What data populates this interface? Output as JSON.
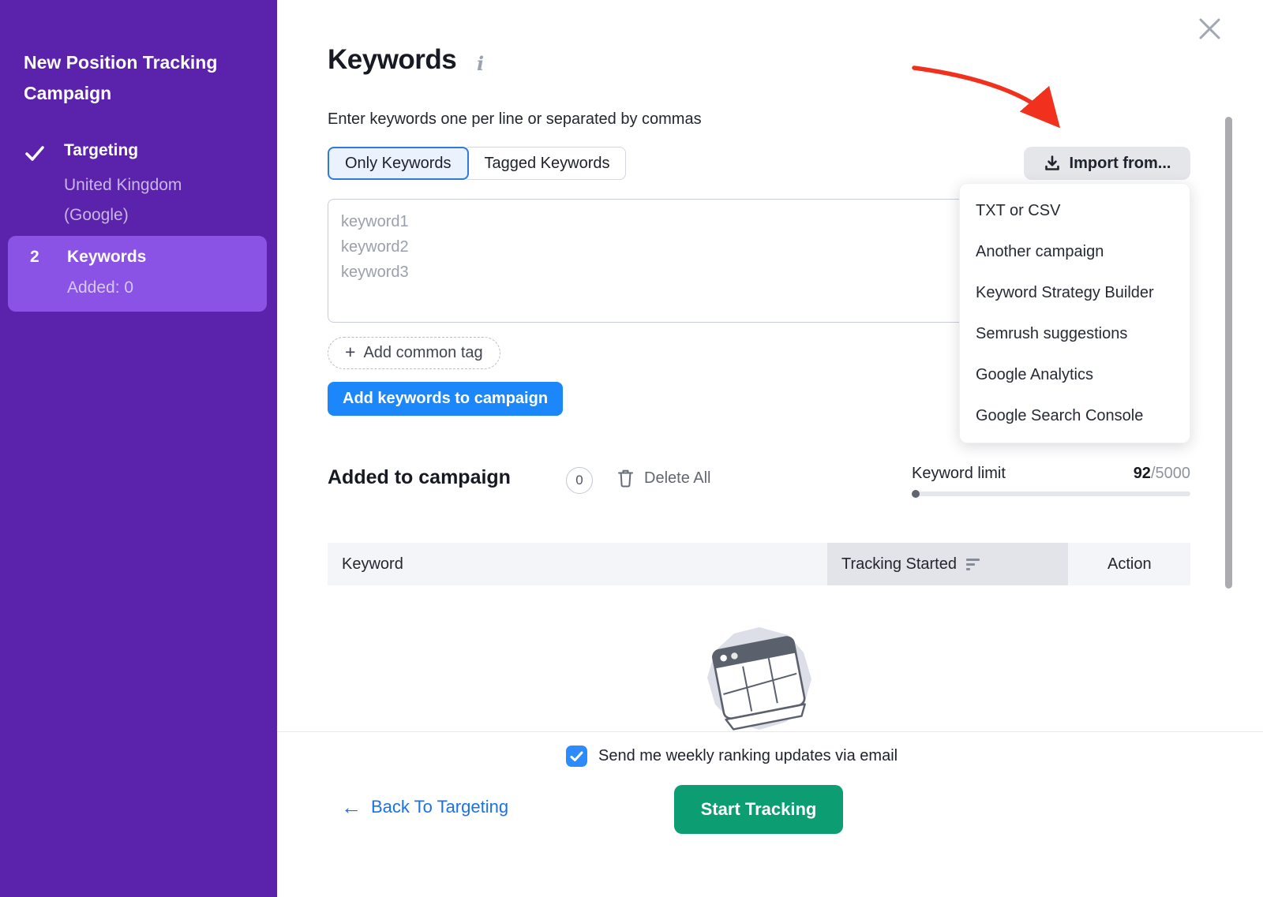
{
  "sidebar": {
    "title": "New Position Tracking Campaign",
    "step_targeting": {
      "label": "Targeting",
      "sub": "United Kingdom (Google)"
    },
    "step_keywords": {
      "number": "2",
      "label": "Keywords",
      "sub": "Added: 0"
    }
  },
  "main": {
    "title": "Keywords",
    "info_glyph": "i",
    "subtitle": "Enter keywords one per line or separated by commas",
    "tabs": {
      "only_keywords": "Only Keywords",
      "tagged_keywords": "Tagged Keywords"
    },
    "import_button": "Import from...",
    "import_menu": [
      "TXT or CSV",
      "Another campaign",
      "Keyword Strategy Builder",
      "Semrush suggestions",
      "Google Analytics",
      "Google Search Console"
    ],
    "keywords_placeholder": "keyword1\nkeyword2\nkeyword3",
    "plus_glyph": "+",
    "add_common_tag": "Add common tag",
    "add_keywords_button": "Add keywords to campaign",
    "added_section": {
      "title": "Added to campaign",
      "count": "0",
      "delete_all": "Delete All"
    },
    "keyword_limit": {
      "label": "Keyword limit",
      "used": "92",
      "total": "/5000"
    },
    "table": {
      "col_keyword": "Keyword",
      "col_tracking": "Tracking Started",
      "col_action": "Action"
    }
  },
  "footer": {
    "checkbox_label": "Send me weekly ranking updates via email",
    "back_arrow_glyph": "←",
    "back_link": "Back To Targeting",
    "start_button": "Start Tracking"
  },
  "colors": {
    "sidebar_bg": "#5b22ab",
    "sidebar_active_bg": "#8a52e5",
    "accent_blue": "#1b87fa",
    "link_blue": "#1a71ea",
    "checkbox_blue": "#2e8bfe",
    "green": "#0c9e72",
    "red_arrow": "#f2301e",
    "tab_selected_border": "#3079e0"
  }
}
